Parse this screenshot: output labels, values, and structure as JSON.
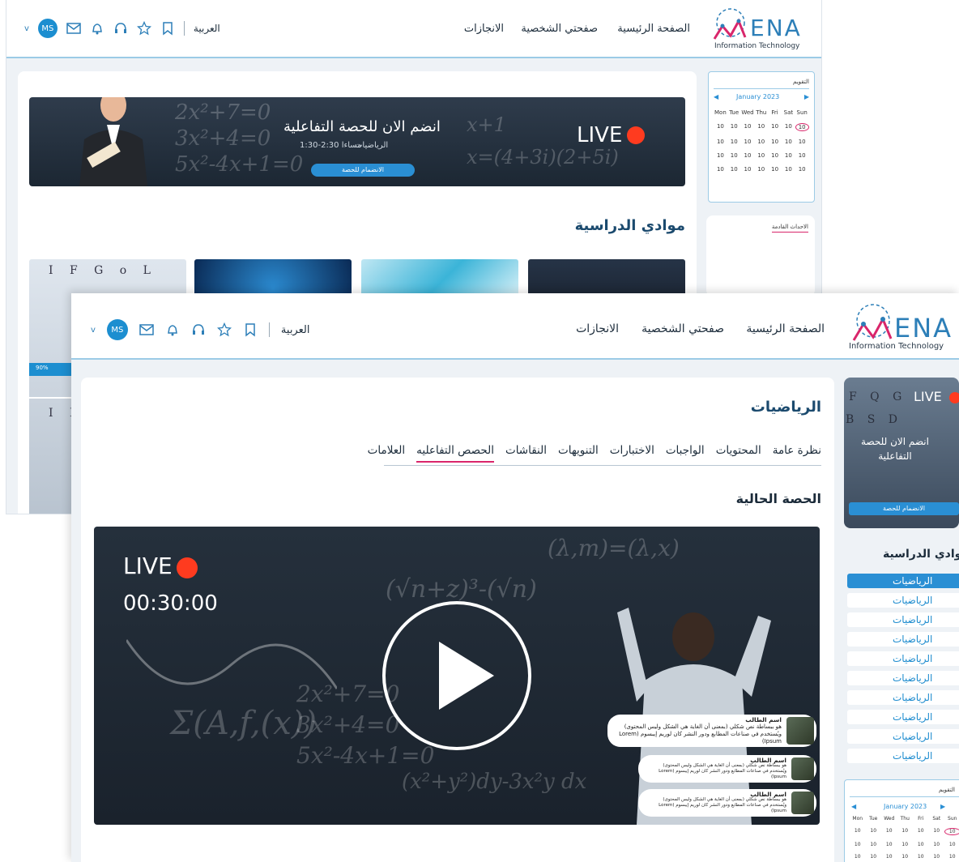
{
  "header": {
    "logo_text": "ENA",
    "logo_sub": "Information Technology",
    "nav": [
      "الصفحة الرئيسية",
      "صفحتي الشخصية",
      "الانجازات"
    ],
    "language": "العربية",
    "avatar": "MS"
  },
  "back_screen": {
    "banner": {
      "live": "LIVE",
      "title": "انضم الان للحصة التفاعلية",
      "subject": "الرياضيات",
      "time": "مساءا 2:30-1:30",
      "join_button": "الانضمام للحصة"
    },
    "section_title": "موادي الدراسية",
    "calendar": {
      "title": "التقويم",
      "month": "January 2023",
      "days": [
        "Mon",
        "Tue",
        "Wed",
        "Thu",
        "Fri",
        "Sat",
        "Sun"
      ],
      "day_value": "10"
    },
    "events_title": "الاحداث القادمة",
    "progress": "90%"
  },
  "front_screen": {
    "subject_title": "الرياضيات",
    "tabs": [
      "نظرة عامة",
      "المحتويات",
      "الواجبات",
      "الاختبارات",
      "التنويهات",
      "النقاشات",
      "الحصص التفاعليه",
      "العلامات"
    ],
    "active_tab": "الحصص التفاعليه",
    "current_class_title": "الحصة الحالية",
    "video": {
      "live": "LIVE",
      "timer": "00:30:00"
    },
    "comments": [
      {
        "name": "اسم الطالب",
        "text": "هو ببساطة نص شكلي (بمعنى أن الغاية هي الشكل وليس المحتوى) ويُستخدم في صناعات المطابع ودور النشر كان لوريم إيبسوم (Lorem Ipsum)"
      },
      {
        "name": "اسم الطالب",
        "text": "هو ببساطة نص شكلي (بمعنى أن الغاية هي الشكل وليس المحتوى) ويُستخدم في صناعات المطابع ودور النشر كان لوريم إيبسوم (Lorem Ipsum)"
      },
      {
        "name": "اسم الطالب",
        "text": "هو ببساطة نص شكلي (بمعنى أن الغاية هي الشكل وليس المحتوى) ويُستخدم في صناعات المطابع ودور النشر كان لوريم إيبسوم (Lorem Ipsum)"
      }
    ],
    "side_banner": {
      "live": "LIVE",
      "title": "انضم الان للحصة التفاعلية",
      "join_button": "الانضمام للحصة"
    },
    "side_section_title": "موادي الدراسية",
    "subjects": [
      "الرياضيات",
      "الرياضيات",
      "الرياضيات",
      "الرياضيات",
      "الرياضيات",
      "الرياضيات",
      "الرياضيات",
      "الرياضيات",
      "الرياضيات",
      "الرياضيات"
    ],
    "calendar": {
      "title": "التقويم",
      "month": "January 2023",
      "days": [
        "Mon",
        "Tue",
        "Wed",
        "Thu",
        "Fri",
        "Sat",
        "Sun"
      ],
      "day_value": "10"
    }
  },
  "colors": {
    "accent": "#2a8fd4",
    "live_dot": "#ff3b1f",
    "active_tab_underline": "#d9266b",
    "header_border": "#9ccbe6"
  }
}
